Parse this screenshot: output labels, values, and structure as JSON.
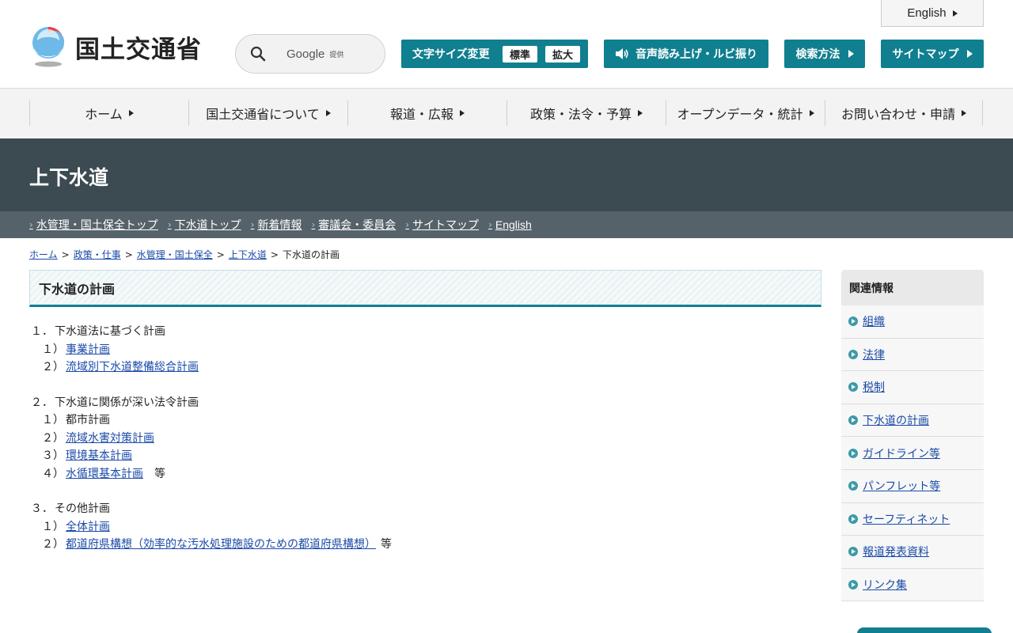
{
  "header": {
    "logo_text": "国土交通省",
    "search": {
      "brand": "Google",
      "sub": "提供"
    },
    "font_size": {
      "label": "文字サイズ変更",
      "standard": "標準",
      "large": "拡大"
    },
    "speech_label": "音声読み上げ・ルビ振り",
    "search_method_label": "検索方法",
    "sitemap_label": "サイトマップ",
    "english_label": "English"
  },
  "gnav": {
    "items": [
      {
        "label": "ホーム"
      },
      {
        "label": "国土交通省について"
      },
      {
        "label": "報道・広報"
      },
      {
        "label": "政策・法令・予算"
      },
      {
        "label": "オープンデータ・統計"
      },
      {
        "label": "お問い合わせ・申請"
      }
    ]
  },
  "section": {
    "title": "上下水道",
    "links": [
      {
        "label": "水管理・国土保全トップ"
      },
      {
        "label": "下水道トップ"
      },
      {
        "label": "新着情報"
      },
      {
        "label": "審議会・委員会"
      },
      {
        "label": "サイトマップ"
      },
      {
        "label": "English"
      }
    ]
  },
  "breadcrumb": {
    "items": [
      {
        "label": "ホーム"
      },
      {
        "label": "政策・仕事"
      },
      {
        "label": "水管理・国土保全"
      },
      {
        "label": "上下水道"
      }
    ],
    "current": "下水道の計画",
    "sep": ">"
  },
  "main": {
    "title": "下水道の計画",
    "sections": [
      {
        "num": "１．",
        "title": "下水道法に基づく計画",
        "items": [
          {
            "num": "１）",
            "label": "事業計画"
          },
          {
            "num": "２）",
            "label": "流域別下水道整備総合計画"
          }
        ]
      },
      {
        "num": "２．",
        "title": "下水道に関係が深い法令計画",
        "items": [
          {
            "num": "１）",
            "text": "都市計画"
          },
          {
            "num": "２）",
            "label": "流域水害対策計画"
          },
          {
            "num": "３）",
            "label": "環境基本計画"
          },
          {
            "num": "４）",
            "label": "水循環基本計画",
            "suffix": "等"
          }
        ]
      },
      {
        "num": "３．",
        "title": "その他計画",
        "items": [
          {
            "num": "１）",
            "label": "全体計画"
          },
          {
            "num": "２）",
            "label": "都道府県構想（効率的な汚水処理施設のための都道府県構想）",
            "suffix": "等"
          }
        ]
      }
    ]
  },
  "sidebar": {
    "title": "関連情報",
    "items": [
      {
        "label": "組織"
      },
      {
        "label": "法律"
      },
      {
        "label": "税制"
      },
      {
        "label": "下水道の計画"
      },
      {
        "label": "ガイドライン等"
      },
      {
        "label": "パンフレット等"
      },
      {
        "label": "セーフティネット"
      },
      {
        "label": "報道発表資料"
      },
      {
        "label": "リンク集"
      }
    ]
  },
  "colors": {
    "accent": "#107f8f",
    "band": "#3c4a52",
    "subnav": "#566269",
    "link": "#1a4aa8"
  },
  "icons": {
    "logo": "mlit-logo-icon",
    "search": "search-icon",
    "speaker": "speaker-icon",
    "arrow": "triangle-right-icon",
    "sidebar_bullet": "circle-arrow-icon"
  }
}
